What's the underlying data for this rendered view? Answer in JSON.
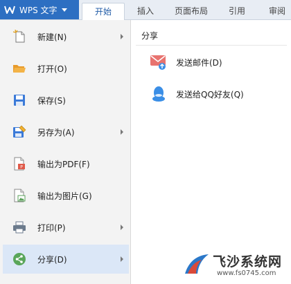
{
  "app": {
    "title": "WPS 文字"
  },
  "tabs": [
    {
      "label": "开始",
      "active": true
    },
    {
      "label": "插入"
    },
    {
      "label": "页面布局"
    },
    {
      "label": "引用"
    },
    {
      "label": "审阅"
    }
  ],
  "menu": {
    "items": [
      {
        "label": "新建(N)",
        "icon": "new-document-icon",
        "submenu": true
      },
      {
        "label": "打开(O)",
        "icon": "folder-open-icon"
      },
      {
        "label": "保存(S)",
        "icon": "save-icon"
      },
      {
        "label": "另存为(A)",
        "icon": "save-as-icon",
        "submenu": true
      },
      {
        "label": "输出为PDF(F)",
        "icon": "export-pdf-icon"
      },
      {
        "label": "输出为图片(G)",
        "icon": "export-image-icon"
      },
      {
        "label": "打印(P)",
        "icon": "printer-icon",
        "submenu": true
      },
      {
        "label": "分享(D)",
        "icon": "share-icon",
        "submenu": true,
        "selected": true
      }
    ]
  },
  "share_panel": {
    "title": "分享",
    "items": [
      {
        "label": "发送邮件(D)",
        "icon": "mail-icon"
      },
      {
        "label": "发送给QQ好友(Q)",
        "icon": "qq-icon"
      }
    ]
  },
  "watermark": {
    "brand": "飞沙系统网",
    "url": "www.fs0745.com"
  },
  "colors": {
    "accent": "#2d6fc2",
    "selected_bg": "#dbe7f7",
    "mail": "#e8736f",
    "qq": "#3a8ee6"
  }
}
